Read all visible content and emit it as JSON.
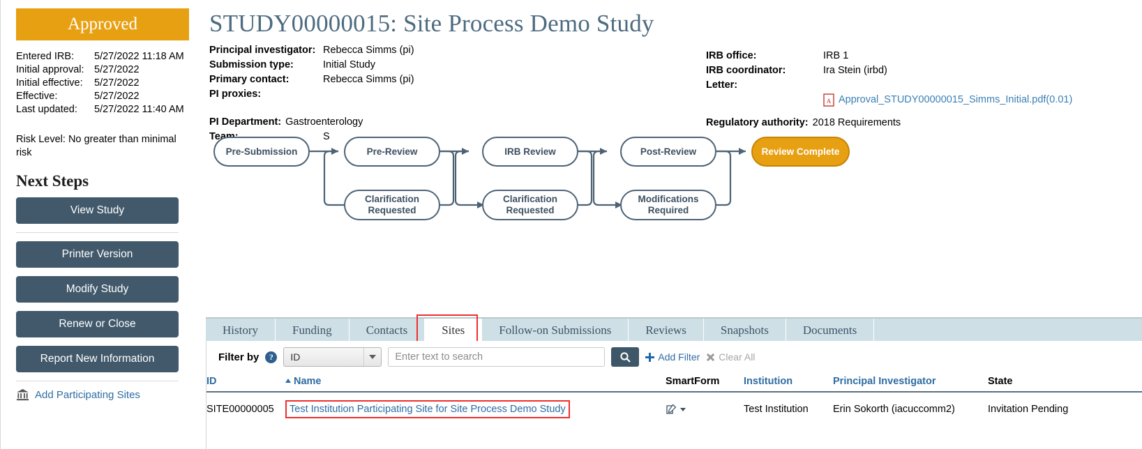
{
  "sidebar": {
    "status": "Approved",
    "meta": [
      {
        "label": "Entered IRB:",
        "value": "5/27/2022 11:18 AM"
      },
      {
        "label": "Initial approval:",
        "value": "5/27/2022"
      },
      {
        "label": "Initial effective:",
        "value": "5/27/2022"
      },
      {
        "label": "Effective:",
        "value": "5/27/2022"
      },
      {
        "label": "Last updated:",
        "value": "5/27/2022 11:40 AM"
      }
    ],
    "risk_label": "Risk Level:",
    "risk_value": "No greater than minimal risk",
    "next_steps_title": "Next Steps",
    "buttons": [
      {
        "label": "View Study"
      },
      {
        "label": "Printer Version"
      },
      {
        "label": "Modify Study"
      },
      {
        "label": "Renew or Close"
      },
      {
        "label": "Report New Information"
      }
    ],
    "add_sites_label": "Add Participating Sites"
  },
  "header": {
    "title": "STUDY00000015: Site Process Demo Study",
    "left_fields": [
      {
        "label": "Principal investigator:",
        "value": "Rebecca Simms (pi)"
      },
      {
        "label": "Submission type:",
        "value": "Initial Study"
      },
      {
        "label": "Primary contact:",
        "value": "Rebecca Simms (pi)"
      },
      {
        "label": "PI proxies:",
        "value": ""
      }
    ],
    "pi_department_label": "PI Department:",
    "pi_department_value": "Gastroenterology",
    "team_label": "Team:",
    "team_value": "S",
    "right_fields": [
      {
        "label": "IRB office:",
        "value": "IRB 1"
      },
      {
        "label": "IRB coordinator:",
        "value": "Ira Stein (irbd)"
      }
    ],
    "letter_label": "Letter:",
    "letter_file": "Approval_STUDY00000015_Simms_Initial.pdf(0.01)",
    "regulatory_label": "Regulatory authority:",
    "regulatory_value": "2018 Requirements"
  },
  "workflow": {
    "nodes": [
      {
        "label": "Pre-Submission",
        "active": false
      },
      {
        "label": "Pre-Review",
        "active": false
      },
      {
        "label": "IRB Review",
        "active": false
      },
      {
        "label": "Post-Review",
        "active": false
      },
      {
        "label": "Review Complete",
        "active": true
      },
      {
        "label": "Clarification Requested",
        "active": false
      },
      {
        "label": "Clarification Requested",
        "active": false
      },
      {
        "label": "Modifications Required",
        "active": false
      }
    ]
  },
  "tabs": [
    {
      "label": "History",
      "active": false
    },
    {
      "label": "Funding",
      "active": false
    },
    {
      "label": "Contacts",
      "active": false
    },
    {
      "label": "Sites",
      "active": true
    },
    {
      "label": "Follow-on Submissions",
      "active": false
    },
    {
      "label": "Reviews",
      "active": false
    },
    {
      "label": "Snapshots",
      "active": false
    },
    {
      "label": "Documents",
      "active": false
    }
  ],
  "filter": {
    "label": "Filter by",
    "help": "?",
    "selected": "ID",
    "search_value": "",
    "search_placeholder": "Enter text to search",
    "add_filter": "Add Filter",
    "clear_all": "Clear All"
  },
  "table": {
    "headers": {
      "id": "ID",
      "name": "Name",
      "smartform": "SmartForm",
      "institution": "Institution",
      "pi": "Principal Investigator",
      "state": "State"
    },
    "sorted_column": "Name",
    "rows": [
      {
        "id": "SITE00000005",
        "name": "Test Institution Participating Site for Site Process Demo Study",
        "institution": "Test Institution",
        "pi": "Erin Sokorth (iacuccomm2)",
        "state": "Invitation Pending"
      }
    ]
  },
  "colors": {
    "status_orange": "#e8a013",
    "button_slate": "#42596b",
    "link_blue": "#2e6ca3",
    "tab_blue": "#cedfe6",
    "highlight_red": "#ef2d2d"
  }
}
